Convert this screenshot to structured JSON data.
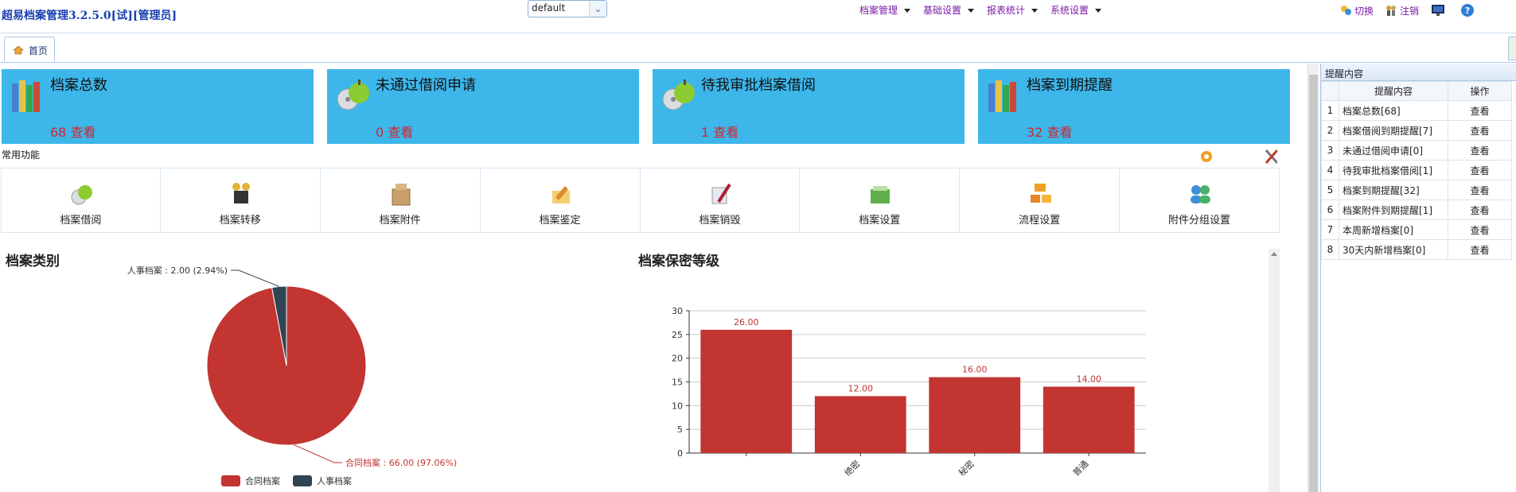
{
  "header": {
    "app_title": "超易档案管理3.2.5.0[试][管理员]",
    "theme_select": "default",
    "menu": [
      {
        "label": "档案管理"
      },
      {
        "label": "基础设置"
      },
      {
        "label": "报表统计"
      },
      {
        "label": "系统设置"
      }
    ],
    "switch_label": "切换",
    "logout_label": "注销"
  },
  "tabs": [
    {
      "label": "首页"
    }
  ],
  "cards": [
    {
      "title": "档案总数",
      "count": "68",
      "view": "查看",
      "icon": "books-icon"
    },
    {
      "title": "未通过借阅申请",
      "count": "0",
      "view": "查看",
      "icon": "disc-apple-icon"
    },
    {
      "title": "待我审批档案借阅",
      "count": "1",
      "view": "查看",
      "icon": "disc-apple-icon"
    },
    {
      "title": "档案到期提醒",
      "count": "32",
      "view": "查看",
      "icon": "books-icon"
    }
  ],
  "common_functions_label": "常用功能",
  "functions": [
    {
      "label": "档案借阅",
      "icon": "borrow-icon"
    },
    {
      "label": "档案转移",
      "icon": "transfer-icon"
    },
    {
      "label": "档案附件",
      "icon": "attachment-box-icon"
    },
    {
      "label": "档案鉴定",
      "icon": "appraise-icon"
    },
    {
      "label": "档案销毁",
      "icon": "destroy-icon"
    },
    {
      "label": "档案设置",
      "icon": "folder-settings-icon"
    },
    {
      "label": "流程设置",
      "icon": "workflow-icon"
    },
    {
      "label": "附件分组设置",
      "icon": "users-group-icon"
    }
  ],
  "reminders": {
    "panel_title": "提醒内容",
    "col_content": "提醒内容",
    "col_action": "操作",
    "rows": [
      {
        "no": "1",
        "content": "档案总数[68]",
        "action": "查看"
      },
      {
        "no": "2",
        "content": "档案借阅到期提醒[7]",
        "action": "查看"
      },
      {
        "no": "3",
        "content": "未通过借阅申请[0]",
        "action": "查看"
      },
      {
        "no": "4",
        "content": "待我审批档案借阅[1]",
        "action": "查看"
      },
      {
        "no": "5",
        "content": "档案到期提醒[32]",
        "action": "查看"
      },
      {
        "no": "6",
        "content": "档案附件到期提醒[1]",
        "action": "查看"
      },
      {
        "no": "7",
        "content": "本周新增档案[0]",
        "action": "查看"
      },
      {
        "no": "8",
        "content": "30天内新增档案[0]",
        "action": "查看"
      }
    ]
  },
  "colors": {
    "card_bg": "#3db6ea",
    "series_red": "#c23531",
    "series_dark": "#2f4554",
    "menu_purple": "#7a1aa8"
  },
  "chart_data": [
    {
      "type": "pie",
      "title": "档案类别",
      "slices": [
        {
          "name": "合同档案",
          "value": 66,
          "percent": 97.06,
          "label": "合同档案 : 66.00 (97.06%)"
        },
        {
          "name": "人事档案",
          "value": 2,
          "percent": 2.94,
          "label": "人事档案 : 2.00 (2.94%)"
        }
      ],
      "legend": [
        "合同档案",
        "人事档案"
      ],
      "legend_position": "bottom"
    },
    {
      "type": "bar",
      "title": "档案保密等级",
      "categories": [
        "",
        "绝密",
        "秘密",
        "普通"
      ],
      "values": [
        26,
        12,
        16,
        14
      ],
      "value_labels": [
        "26.00",
        "12.00",
        "16.00",
        "14.00"
      ],
      "ylim": [
        0,
        30
      ],
      "yticks": [
        0,
        5,
        10,
        15,
        20,
        25,
        30
      ],
      "grid": true
    }
  ]
}
